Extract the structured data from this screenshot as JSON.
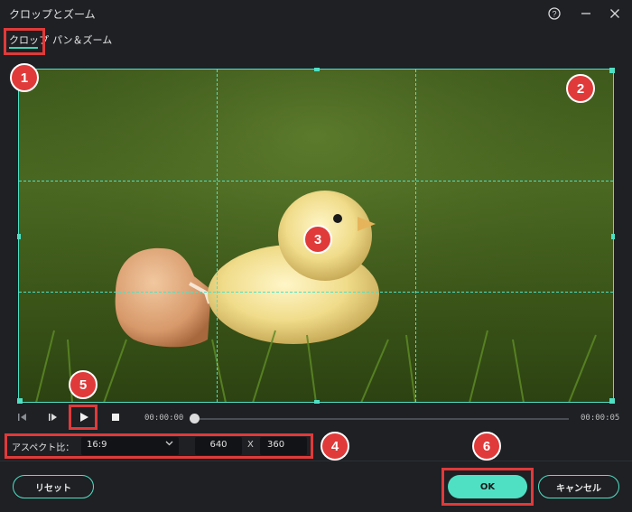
{
  "window": {
    "title": "クロップとズーム",
    "help_icon": "?",
    "min_icon": "—",
    "close_icon": "✕"
  },
  "tabs": [
    {
      "label": "クロップ",
      "active": true
    },
    {
      "label": "パン＆ズーム",
      "active": false
    }
  ],
  "annotations": [
    "1",
    "2",
    "3",
    "4",
    "5",
    "6"
  ],
  "player": {
    "time_current": "00:00:00",
    "time_end": "00:00:05",
    "progress": 0
  },
  "crop": {
    "aspect_label": "アスペクト比：",
    "aspect_value": "16:9",
    "width": "640",
    "separator": "X",
    "height": "360"
  },
  "buttons": {
    "reset": "リセット",
    "ok": "OK",
    "cancel": "キャンセル"
  },
  "colors": {
    "accent": "#4fe0c4",
    "annotation": "#e03a3a",
    "background": "#1e2024"
  }
}
